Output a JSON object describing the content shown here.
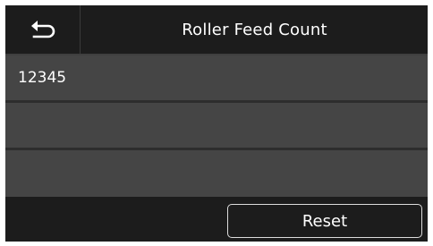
{
  "header": {
    "title": "Roller Feed Count",
    "back_icon": "back-arrow-icon"
  },
  "rows": [
    {
      "value": "12345"
    },
    {
      "value": ""
    },
    {
      "value": ""
    }
  ],
  "footer": {
    "reset_label": "Reset"
  },
  "colors": {
    "header_bg": "#1c1c1c",
    "row_bg": "#454545",
    "separator": "#2d2d2d",
    "text": "#ffffff"
  }
}
